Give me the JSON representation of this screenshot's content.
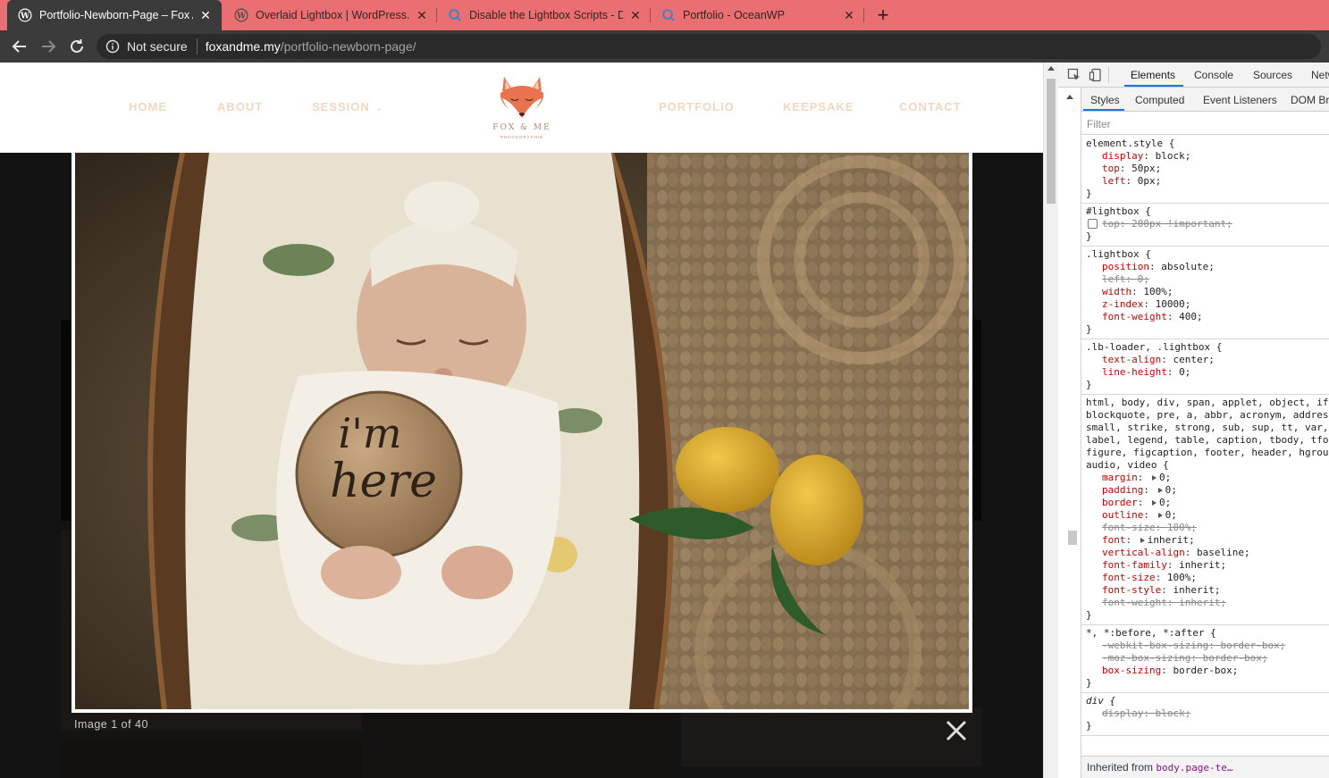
{
  "browser": {
    "tabs": [
      {
        "title": "Portfolio-Newborn-Page – Fox And Me",
        "icon": "wordpress-icon",
        "active": true
      },
      {
        "title": "Overlaid Lightbox | WordPress.org",
        "icon": "wordpress-icon",
        "active": false
      },
      {
        "title": "Disable the Lightbox Scripts - Docs",
        "icon": "oceanwp-search-icon",
        "active": false
      },
      {
        "title": "Portfolio - OceanWP",
        "icon": "oceanwp-search-icon",
        "active": false
      }
    ],
    "close_glyph": "✕",
    "new_tab_glyph": "+",
    "security_label": "Not secure",
    "url_host": "foxandme.my",
    "url_path": "/portfolio-newborn-page/"
  },
  "site": {
    "nav_left": [
      "HOME",
      "ABOUT",
      "SESSION"
    ],
    "nav_right": [
      "PORTFOLIO",
      "KEEPSAKE",
      "CONTACT"
    ],
    "logo_name": "FOX & ME",
    "logo_sub": "PHOTOGRAPHIE",
    "accent_color": "#f2d7c1"
  },
  "lightbox": {
    "caption": "Image 1 of 40",
    "sign_text_1": "i'm",
    "sign_text_2": "here"
  },
  "devtools": {
    "tabs": [
      "Elements",
      "Console",
      "Sources",
      "Network"
    ],
    "active_tab": "Elements",
    "subtabs": [
      "Styles",
      "Computed",
      "Event Listeners",
      "DOM Breakpoints"
    ],
    "filter_placeholder": "Filter",
    "rules": [
      {
        "selector": "element.style {",
        "props": [
          {
            "name": "display",
            "value": "block;"
          },
          {
            "name": "top",
            "value": "50px;"
          },
          {
            "name": "left",
            "value": "0px;"
          }
        ]
      },
      {
        "selector": "#lightbox {",
        "props": [
          {
            "name": "top",
            "value": "200px !important;",
            "struck": true,
            "checkbox": true
          }
        ]
      },
      {
        "selector": ".lightbox {",
        "props": [
          {
            "name": "position",
            "value": "absolute;"
          },
          {
            "name": "left",
            "value": "0;",
            "struck": true
          },
          {
            "name": "width",
            "value": "100%;"
          },
          {
            "name": "z-index",
            "value": "10000;"
          },
          {
            "name": "font-weight",
            "value": "400;"
          }
        ]
      },
      {
        "selector": ".lb-loader, .lightbox {",
        "props": [
          {
            "name": "text-align",
            "value": "center;"
          },
          {
            "name": "line-height",
            "value": "0;"
          }
        ]
      },
      {
        "selector": "html, body, div, span, applet, object, iframe,",
        "selector_extra": [
          "blockquote, pre, a, abbr, acronym, address,",
          "small, strike, strong, sub, sup, tt, var, b,",
          "label, legend, table, caption, tbody, tfoot,",
          "figure, figcaption, footer, header, hgroup,",
          "audio, video {"
        ],
        "props": [
          {
            "name": "margin",
            "value": "0;",
            "tri": true
          },
          {
            "name": "padding",
            "value": "0;",
            "tri": true
          },
          {
            "name": "border",
            "value": "0;",
            "tri": true
          },
          {
            "name": "outline",
            "value": "0;",
            "tri": true
          },
          {
            "name": "font-size",
            "value": "100%;",
            "struck": true
          },
          {
            "name": "font",
            "value": "inherit;",
            "tri": true
          },
          {
            "name": "vertical-align",
            "value": "baseline;"
          },
          {
            "name": "font-family",
            "value": "inherit;"
          },
          {
            "name": "font-size",
            "value": "100%;"
          },
          {
            "name": "font-style",
            "value": "inherit;"
          },
          {
            "name": "font-weight",
            "value": "inherit;",
            "struck": true
          }
        ]
      },
      {
        "selector": "*, *:before, *:after {",
        "props": [
          {
            "name": "-webkit-box-sizing",
            "value": "border-box;",
            "struck": true
          },
          {
            "name": "-moz-box-sizing",
            "value": "border-box;",
            "struck": true
          },
          {
            "name": "box-sizing",
            "value": "border-box;"
          }
        ]
      },
      {
        "selector": "div {",
        "italic": true,
        "props": [
          {
            "name": "display",
            "value": "block;",
            "struck": true
          }
        ]
      }
    ],
    "inherited_label": "Inherited from",
    "inherited_link": "body.page-te…"
  }
}
